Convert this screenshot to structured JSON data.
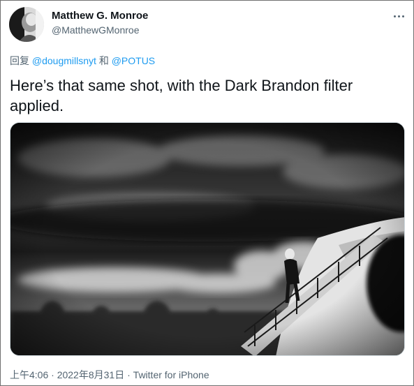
{
  "author": {
    "name": "Matthew G. Monroe",
    "handle": "@MatthewGMonroe"
  },
  "reply": {
    "prefix": "回复",
    "mention1": "@dougmillsnyt",
    "joiner": "和",
    "mention2": "@POTUS"
  },
  "tweet": {
    "text": "Here’s that same shot, with the Dark Brandon filter applied."
  },
  "media": {
    "description_icon": "photo-black-white"
  },
  "meta": {
    "time": "上午4:06",
    "sep1": "·",
    "date": "2022年8月31日",
    "sep2": "·",
    "source": "Twitter for iPhone"
  },
  "colors": {
    "link": "#1d9bf0",
    "secondary_text": "#536471",
    "primary_text": "#0f1419"
  }
}
